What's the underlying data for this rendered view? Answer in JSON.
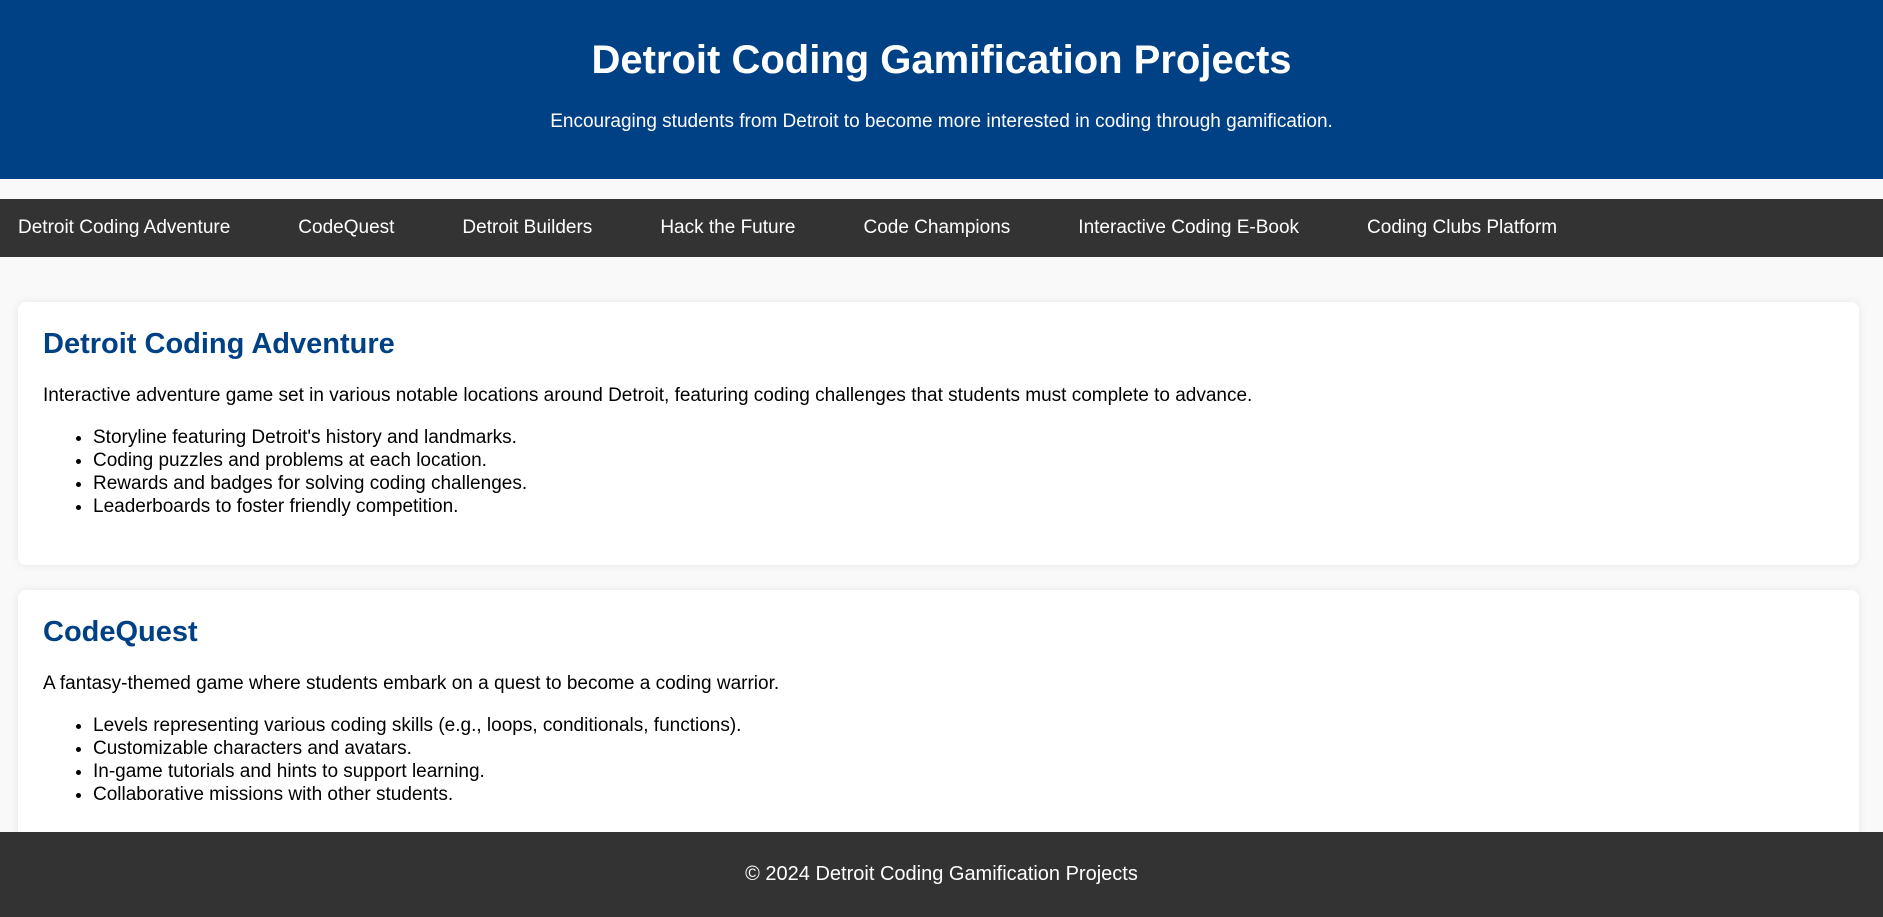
{
  "header": {
    "title": "Detroit Coding Gamification Projects",
    "subtitle": "Encouraging students from Detroit to become more interested in coding through gamification."
  },
  "nav": {
    "items": [
      {
        "label": "Detroit Coding Adventure"
      },
      {
        "label": "CodeQuest"
      },
      {
        "label": "Detroit Builders"
      },
      {
        "label": "Hack the Future"
      },
      {
        "label": "Code Champions"
      },
      {
        "label": "Interactive Coding E-Book"
      },
      {
        "label": "Coding Clubs Platform"
      }
    ]
  },
  "projects": [
    {
      "title": "Detroit Coding Adventure",
      "description": "Interactive adventure game set in various notable locations around Detroit, featuring coding challenges that students must complete to advance.",
      "features": [
        "Storyline featuring Detroit's history and landmarks.",
        "Coding puzzles and problems at each location.",
        "Rewards and badges for solving coding challenges.",
        "Leaderboards to foster friendly competition."
      ]
    },
    {
      "title": "CodeQuest",
      "description": "A fantasy-themed game where students embark on a quest to become a coding warrior.",
      "features": [
        "Levels representing various coding skills (e.g., loops, conditionals, functions).",
        "Customizable characters and avatars.",
        "In-game tutorials and hints to support learning.",
        "Collaborative missions with other students."
      ]
    }
  ],
  "footer": {
    "text": "© 2024 Detroit Coding Gamification Projects"
  },
  "colors": {
    "header_bg": "#004085",
    "nav_bg": "#333333",
    "accent": "#004085",
    "page_bg": "#f9f9f9"
  }
}
